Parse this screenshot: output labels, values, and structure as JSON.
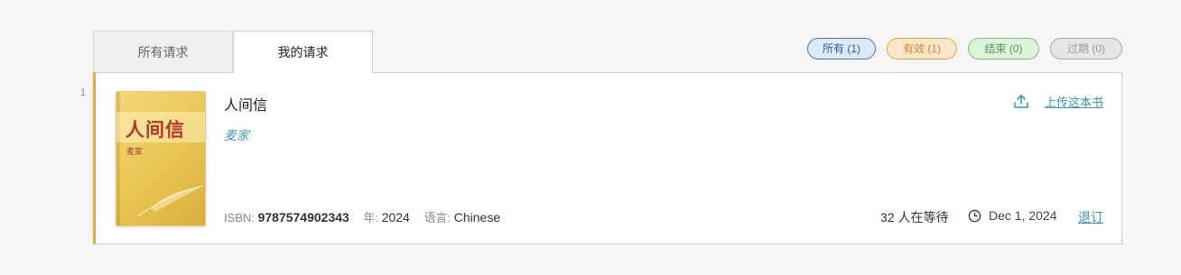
{
  "tabs": {
    "all_label": "所有请求",
    "mine_label": "我的请求"
  },
  "filters": {
    "all": "所有 (1)",
    "valid": "有效 (1)",
    "done": "结束 (0)",
    "expired": "过期 (0)"
  },
  "colors": {
    "accent_orange": "#e6a84b",
    "link_blue": "#3c95b3"
  },
  "requests": [
    {
      "index": "1",
      "cover_title": "人间信",
      "cover_author": "麦家",
      "title": "人间信",
      "author": "麦家",
      "isbn_label": "ISBN:",
      "isbn": "9787574902343",
      "year_label": "年:",
      "year": "2024",
      "lang_label": "语言:",
      "language": "Chinese",
      "upload_label": "上传这本书",
      "upload_icon": "upload-icon",
      "waiting": "32 人在等待",
      "clock_icon": "clock-icon",
      "date": "Dec 1, 2024",
      "cancel_label": "退订"
    }
  ]
}
